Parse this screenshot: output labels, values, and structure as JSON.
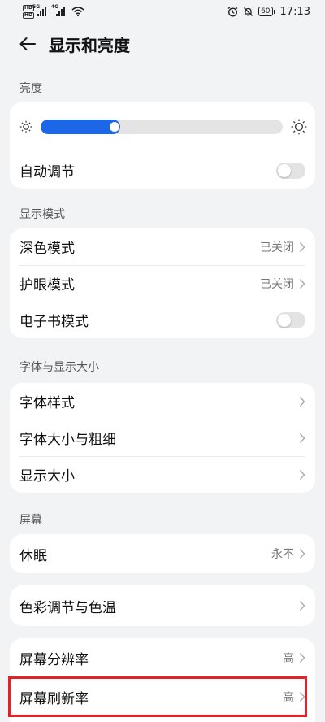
{
  "status_bar": {
    "hd1": "HD",
    "hd2": "HD",
    "sim1_type": "5G",
    "sim2_type": "4G",
    "battery": "60",
    "time": "17:13"
  },
  "header": {
    "title": "显示和亮度"
  },
  "brightness": {
    "section_label": "亮度",
    "level_percent": 33,
    "auto_label": "自动调节",
    "auto_on": false
  },
  "display_mode": {
    "section_label": "显示模式",
    "dark_mode": {
      "label": "深色模式",
      "value": "已关闭"
    },
    "eye_comfort": {
      "label": "护眼模式",
      "value": "已关闭"
    },
    "ebook": {
      "label": "电子书模式",
      "on": false
    }
  },
  "font_size": {
    "section_label": "字体与显示大小",
    "font_style": {
      "label": "字体样式"
    },
    "font_size_weight": {
      "label": "字体大小与粗细"
    },
    "display_size": {
      "label": "显示大小"
    }
  },
  "screen": {
    "section_label": "屏幕",
    "sleep": {
      "label": "休眠",
      "value": "永不"
    },
    "color_temp": {
      "label": "色彩调节与色温"
    },
    "resolution": {
      "label": "屏幕分辨率",
      "value": "高"
    },
    "refresh_rate": {
      "label": "屏幕刷新率",
      "value": "高"
    }
  },
  "colors": {
    "accent": "#1b67e8",
    "highlight": "#e32227",
    "background": "#f1f3f5"
  }
}
